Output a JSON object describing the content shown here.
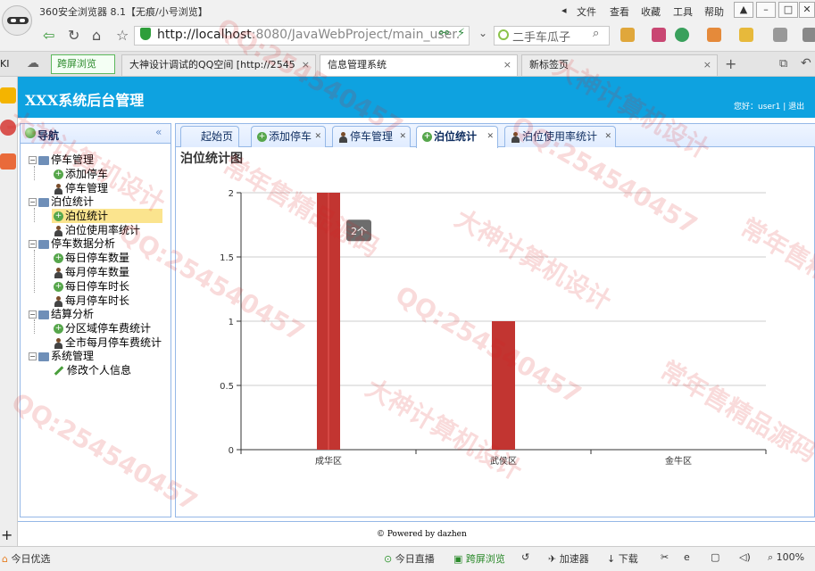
{
  "browser": {
    "window_title": "360安全浏览器 8.1【无痕/小号浏览】",
    "menu": [
      "文件",
      "查看",
      "收藏",
      "工具",
      "帮助"
    ],
    "url_host": "http://localhost",
    "url_rest": ":8080/JavaWebProject/main_user.",
    "search_placeholder": "二手车瓜子",
    "tabs": [
      {
        "label": "跨屏浏览"
      },
      {
        "label": "大神设计调试的QQ空间 [http://2545"
      },
      {
        "label": "信息管理系统",
        "active": true
      },
      {
        "label": "新标签页"
      }
    ]
  },
  "app": {
    "title": "XXX系统后台管理",
    "user_info": "您好：user1 | 退出"
  },
  "nav": {
    "title": "导航",
    "collapse": "«",
    "tree": [
      {
        "label": "停车管理",
        "level": 0
      },
      {
        "label": "添加停车",
        "level": 1,
        "icon": "add-icon"
      },
      {
        "label": "停车管理",
        "level": 1,
        "icon": "person-icon"
      },
      {
        "label": "泊位统计",
        "level": 0
      },
      {
        "label": "泊位统计",
        "level": 1,
        "icon": "add-icon",
        "selected": true
      },
      {
        "label": "泊位使用率统计",
        "level": 1,
        "icon": "person-icon"
      },
      {
        "label": "停车数据分析",
        "level": 0
      },
      {
        "label": "每日停车数量",
        "level": 1,
        "icon": "add-icon"
      },
      {
        "label": "每月停车数量",
        "level": 1,
        "icon": "person-icon"
      },
      {
        "label": "每日停车时长",
        "level": 1,
        "icon": "add-icon"
      },
      {
        "label": "每月停车时长",
        "level": 1,
        "icon": "person-icon"
      },
      {
        "label": "结算分析",
        "level": 0
      },
      {
        "label": "分区域停车费统计",
        "level": 1,
        "icon": "add-icon"
      },
      {
        "label": "全市每月停车费统计",
        "level": 1,
        "icon": "person-icon"
      },
      {
        "label": "系统管理",
        "level": 0
      },
      {
        "label": "修改个人信息",
        "level": 1,
        "icon": "pen-icon"
      }
    ]
  },
  "content_tabs": [
    {
      "label": "起始页",
      "closable": false
    },
    {
      "label": "添加停车",
      "icon": "add-icon",
      "closable": true
    },
    {
      "label": "停车管理",
      "icon": "person-icon",
      "closable": true
    },
    {
      "label": "泊位统计",
      "icon": "add-icon",
      "closable": true,
      "active": true
    },
    {
      "label": "泊位使用率统计",
      "icon": "person-icon",
      "closable": true
    }
  ],
  "chart_data": {
    "type": "bar",
    "title": "泊位统计图",
    "categories": [
      "成华区",
      "武侯区",
      "金牛区"
    ],
    "values": [
      2,
      1,
      0
    ],
    "ylim": [
      0,
      2
    ],
    "yticks": [
      "0",
      "0.5",
      "1",
      "1.5",
      "2"
    ],
    "tooltip": "2个",
    "bar_color": "#c23531",
    "grid": true
  },
  "footer": {
    "text": "© Powered by dazhen"
  },
  "statusbar": {
    "left": "今日优选",
    "items": [
      "今日直播",
      "跨屏浏览",
      "加速器",
      "下载",
      "100%"
    ]
  },
  "watermarks": [
    "QQ:254540457",
    "大神计算机设计",
    "常年售精品源码",
    "QQ:254540457",
    "大神计算机设计",
    "常年售精品源码",
    "QQ:254540457",
    "QQ:254540457",
    "常年售精品源码",
    "大神计算机设计",
    "QQ:254540457",
    "大神计算机设计"
  ]
}
